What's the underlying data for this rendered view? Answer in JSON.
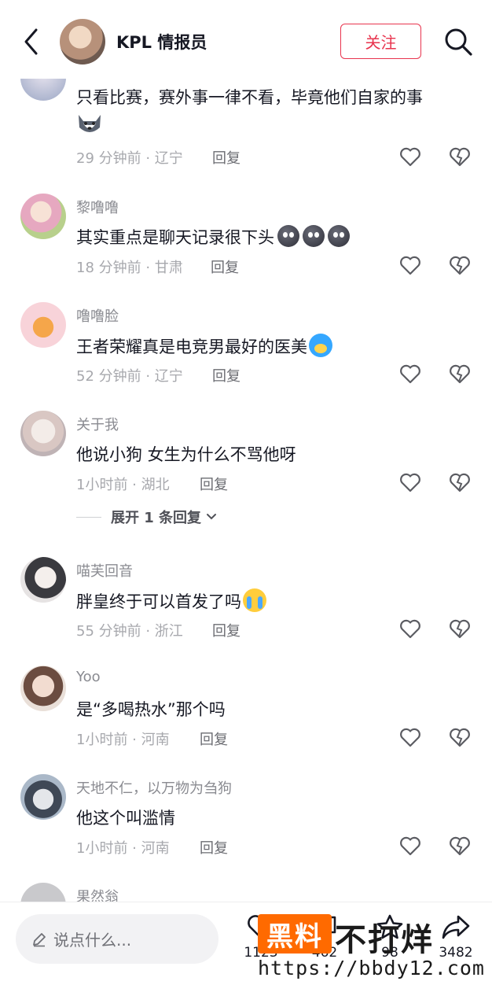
{
  "header": {
    "title": "KPL 情报员",
    "follow_label": "关注"
  },
  "comments": [
    {
      "name": "",
      "text": "只看比赛，赛外事一律不看，毕竟他们自家的事",
      "emoji": "husky-icon",
      "time_location": "29 分钟前 · 辽宁",
      "reply": "回复"
    },
    {
      "name": "黎噜噜",
      "text": "其实重点是聊天记录很下头",
      "emoji": "ball-emoji x3",
      "time_location": "18 分钟前 · 甘肃",
      "reply": "回复"
    },
    {
      "name": "噜噜脸",
      "text": "王者荣耀真是电竞男最好的医美",
      "emoji": "blue-face-emoji",
      "time_location": "52 分钟前 · 辽宁",
      "reply": "回复"
    },
    {
      "name": "关于我",
      "text": "他说小狗 女生为什么不骂他呀",
      "time_location": "1小时前 · 湖北",
      "reply": "回复"
    },
    {
      "name": "喵芙回音",
      "text": "胖皇终于可以首发了吗",
      "emoji": "crying-emoji",
      "time_location": "55 分钟前 · 浙江",
      "reply": "回复"
    },
    {
      "name": "Yoo",
      "text": "是“多喝热水”那个吗",
      "time_location": "1小时前 · 河南",
      "reply": "回复"
    },
    {
      "name": "天地不仁，以万物为刍狗",
      "text": "他这个叫滥情",
      "time_location": "1小时前 · 河南",
      "reply": "回复"
    },
    {
      "name": "果然翁"
    }
  ],
  "expand_replies": "展开 1 条回复",
  "bottom": {
    "input_placeholder": "说点什么...",
    "like_count": "1123",
    "comment_count": "462",
    "favorite_count": "98",
    "share_count": "3482"
  },
  "watermark": {
    "badge": "黑料",
    "main": "不打烊",
    "url": "https://bbdy12.com"
  },
  "colors": {
    "accent": "#e8344e",
    "watermark_orange": "#ff6a00"
  }
}
